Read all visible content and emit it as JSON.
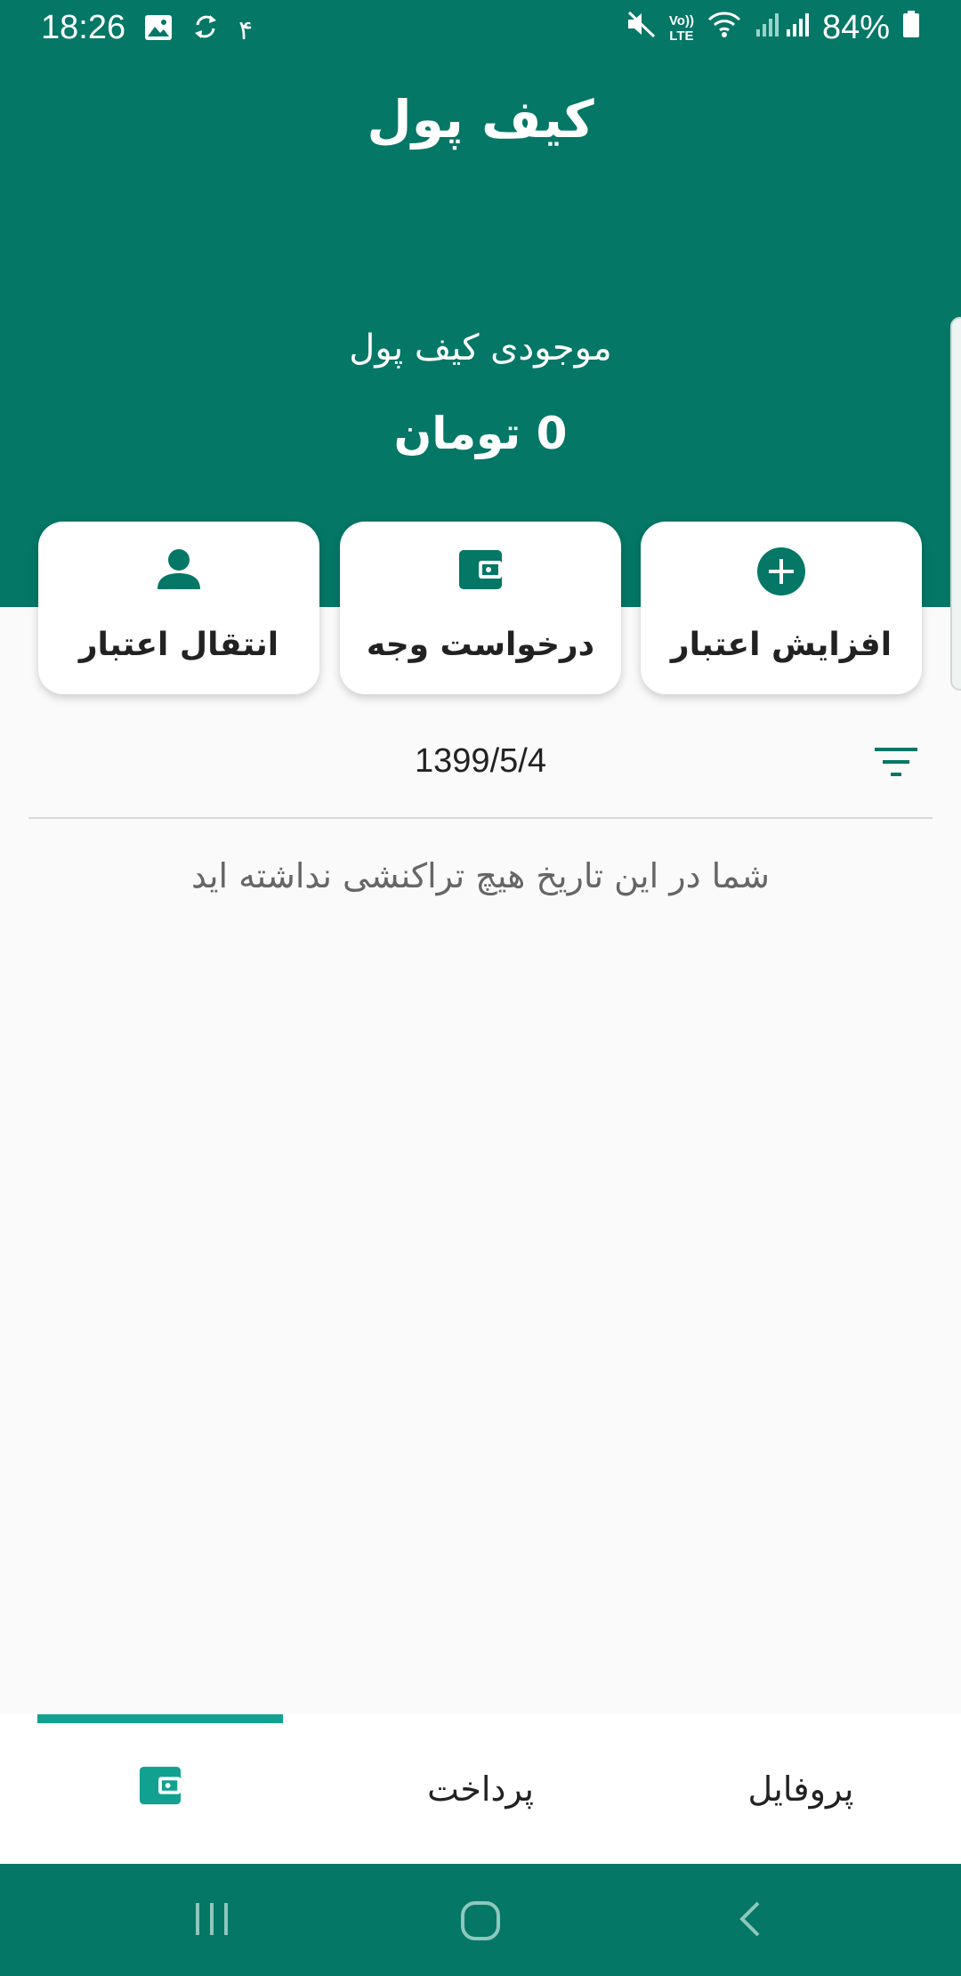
{
  "status_bar": {
    "time": "18:26",
    "extra_indicator": "۴",
    "network_label_top": "Vo))",
    "network_label_bottom": "LTE",
    "battery": "84%",
    "icons": [
      "gallery-icon",
      "sync-icon",
      "mute-icon",
      "wifi-icon",
      "signal-icon",
      "battery-icon"
    ]
  },
  "header": {
    "title": "کیف پول",
    "balance_label": "موجودی کیف پول",
    "balance_value": "0 تومان",
    "background_color": "#047766"
  },
  "actions": [
    {
      "label": "افزایش اعتبار",
      "icon": "add-circle-icon"
    },
    {
      "label": "درخواست وجه",
      "icon": "wallet-icon"
    },
    {
      "label": "انتقال اعتبار",
      "icon": "person-icon"
    }
  ],
  "filter": {
    "date": "1399/5/4",
    "icon": "filter-icon"
  },
  "empty_message": "شما در این تاریخ هیچ تراکنشی نداشته اید",
  "bottom_nav": {
    "items": [
      {
        "label": "",
        "icon": "wallet-icon",
        "active": true
      },
      {
        "label": "پرداخت",
        "active": false
      },
      {
        "label": "پروفایل",
        "active": false
      }
    ],
    "accent_color": "#12a190"
  },
  "system_nav": {
    "icons": [
      "recents-icon",
      "home-icon",
      "back-icon"
    ]
  }
}
